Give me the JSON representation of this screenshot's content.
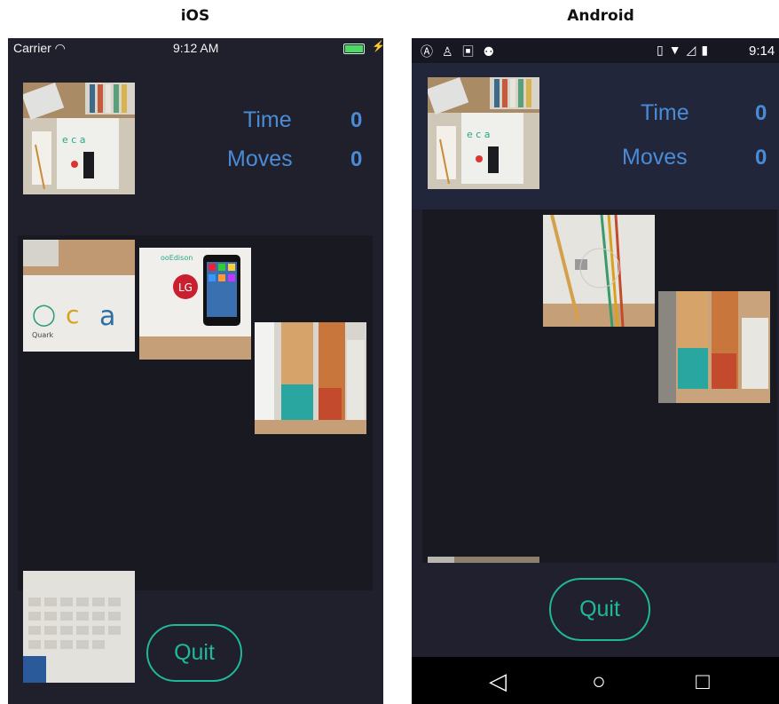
{
  "labels": {
    "ios": "iOS",
    "android": "Android"
  },
  "ios": {
    "status": {
      "carrier": "Carrier",
      "time": "9:12 AM"
    },
    "stats": {
      "time_label": "Time",
      "time_value": "0",
      "moves_label": "Moves",
      "moves_value": "0"
    },
    "quit_label": "Quit"
  },
  "android": {
    "status": {
      "time": "9:14"
    },
    "stats": {
      "time_label": "Time",
      "time_value": "0",
      "moves_label": "Moves",
      "moves_value": "0"
    },
    "quit_label": "Quit"
  },
  "colors": {
    "accent_blue": "#4a8bd6",
    "quit_teal": "#1fb99a",
    "background": "#20202d"
  }
}
